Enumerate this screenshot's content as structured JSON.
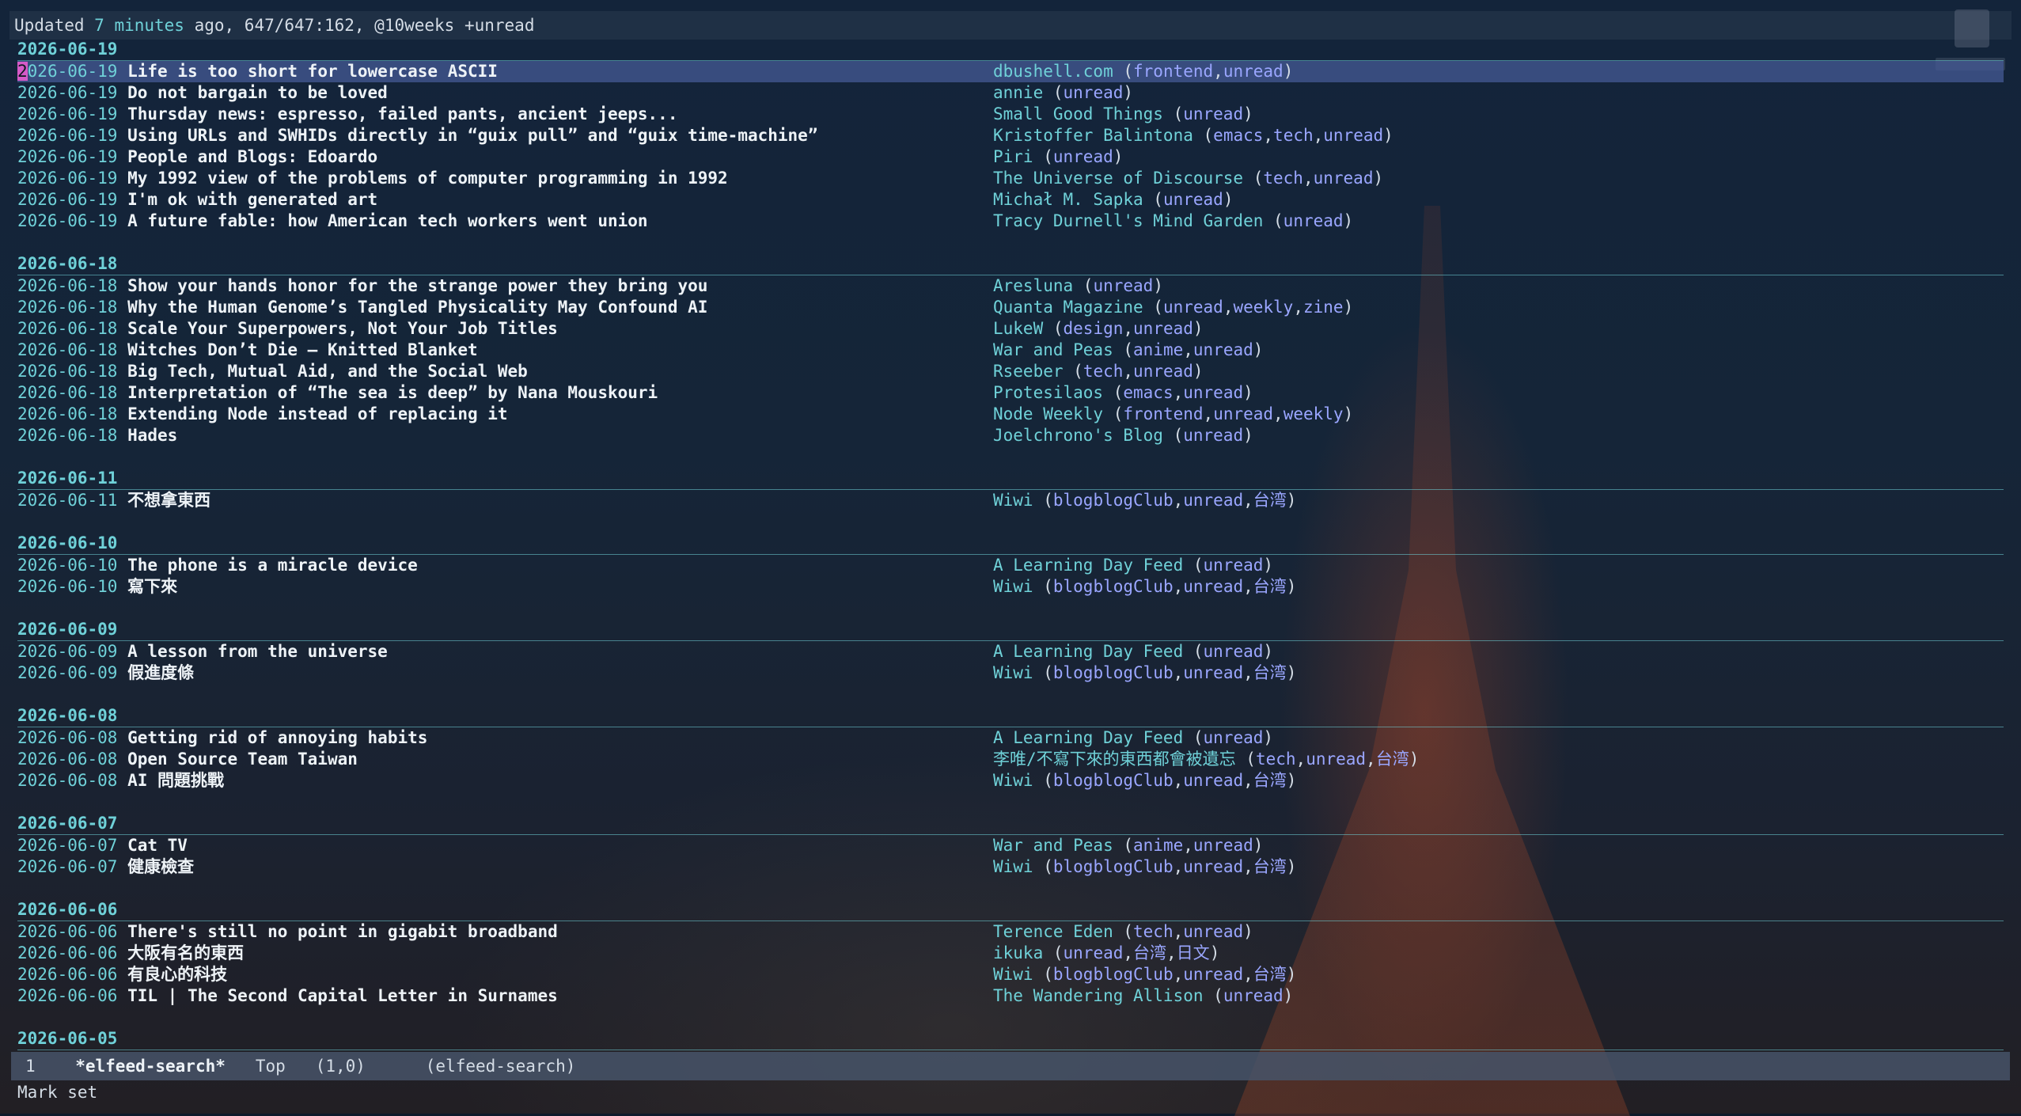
{
  "header": {
    "prefix": "Updated ",
    "age": "7 minutes",
    "suffix": " ago, 647/647:162, @10weeks +unread"
  },
  "groups": [
    {
      "date": "2026-06-19",
      "rows": [
        {
          "date": "2026-06-19",
          "title": "Life is too short for lowercase ASCII",
          "feed": "dbushell.com",
          "tags": [
            "frontend",
            "unread"
          ],
          "selected": true
        },
        {
          "date": "2026-06-19",
          "title": "Do not bargain to be loved",
          "feed": "annie",
          "tags": [
            "unread"
          ]
        },
        {
          "date": "2026-06-19",
          "title": "Thursday news: espresso, failed pants, ancient jeeps...",
          "feed": "Small Good Things",
          "tags": [
            "unread"
          ]
        },
        {
          "date": "2026-06-19",
          "title": "Using URLs and SWHIDs directly in “guix pull” and “guix time-machine”",
          "feed": "Kristoffer Balintona",
          "tags": [
            "emacs",
            "tech",
            "unread"
          ]
        },
        {
          "date": "2026-06-19",
          "title": "People and Blogs: Edoardo",
          "feed": "Piri",
          "tags": [
            "unread"
          ]
        },
        {
          "date": "2026-06-19",
          "title": "My 1992 view of the problems of computer programming in 1992",
          "feed": "The Universe of Discourse",
          "tags": [
            "tech",
            "unread"
          ]
        },
        {
          "date": "2026-06-19",
          "title": "I'm ok with generated art",
          "feed": "Michał M. Sapka",
          "tags": [
            "unread"
          ]
        },
        {
          "date": "2026-06-19",
          "title": "A future fable: how American tech workers went union",
          "feed": "Tracy Durnell's Mind Garden",
          "tags": [
            "unread"
          ]
        }
      ]
    },
    {
      "date": "2026-06-18",
      "rows": [
        {
          "date": "2026-06-18",
          "title": "Show your hands honor for the strange power they bring you",
          "feed": "Aresluna",
          "tags": [
            "unread"
          ]
        },
        {
          "date": "2026-06-18",
          "title": "Why the Human Genome’s Tangled Physicality May Confound AI",
          "feed": "Quanta Magazine",
          "tags": [
            "unread",
            "weekly",
            "zine"
          ]
        },
        {
          "date": "2026-06-18",
          "title": "Scale Your Superpowers, Not Your Job Titles",
          "feed": "LukeW",
          "tags": [
            "design",
            "unread"
          ]
        },
        {
          "date": "2026-06-18",
          "title": "Witches Don’t Die – Knitted Blanket",
          "feed": "War and Peas",
          "tags": [
            "anime",
            "unread"
          ]
        },
        {
          "date": "2026-06-18",
          "title": "Big Tech, Mutual Aid, and the Social Web",
          "feed": "Rseeber",
          "tags": [
            "tech",
            "unread"
          ]
        },
        {
          "date": "2026-06-18",
          "title": "Interpretation of “The sea is deep” by Nana Mouskouri",
          "feed": "Protesilaos",
          "tags": [
            "emacs",
            "unread"
          ]
        },
        {
          "date": "2026-06-18",
          "title": "Extending Node instead of replacing it",
          "feed": "Node Weekly",
          "tags": [
            "frontend",
            "unread",
            "weekly"
          ]
        },
        {
          "date": "2026-06-18",
          "title": "Hades",
          "feed": "Joelchrono's Blog",
          "tags": [
            "unread"
          ]
        }
      ]
    },
    {
      "date": "2026-06-11",
      "rows": [
        {
          "date": "2026-06-11",
          "title": "不想拿東西",
          "feed": "Wiwi",
          "tags": [
            "blogblogClub",
            "unread",
            "台湾"
          ]
        }
      ]
    },
    {
      "date": "2026-06-10",
      "rows": [
        {
          "date": "2026-06-10",
          "title": "The phone is a miracle device",
          "feed": "A Learning Day Feed",
          "tags": [
            "unread"
          ]
        },
        {
          "date": "2026-06-10",
          "title": "寫下來",
          "feed": "Wiwi",
          "tags": [
            "blogblogClub",
            "unread",
            "台湾"
          ]
        }
      ]
    },
    {
      "date": "2026-06-09",
      "rows": [
        {
          "date": "2026-06-09",
          "title": "A lesson from the universe",
          "feed": "A Learning Day Feed",
          "tags": [
            "unread"
          ]
        },
        {
          "date": "2026-06-09",
          "title": "假進度條",
          "feed": "Wiwi",
          "tags": [
            "blogblogClub",
            "unread",
            "台湾"
          ]
        }
      ]
    },
    {
      "date": "2026-06-08",
      "rows": [
        {
          "date": "2026-06-08",
          "title": "Getting rid of annoying habits",
          "feed": "A Learning Day Feed",
          "tags": [
            "unread"
          ]
        },
        {
          "date": "2026-06-08",
          "title": "Open Source Team Taiwan",
          "feed": "李唯/不寫下來的東西都會被遺忘",
          "tags": [
            "tech",
            "unread",
            "台湾"
          ]
        },
        {
          "date": "2026-06-08",
          "title": "AI 問題挑戰",
          "feed": "Wiwi",
          "tags": [
            "blogblogClub",
            "unread",
            "台湾"
          ]
        }
      ]
    },
    {
      "date": "2026-06-07",
      "rows": [
        {
          "date": "2026-06-07",
          "title": "Cat TV",
          "feed": "War and Peas",
          "tags": [
            "anime",
            "unread"
          ]
        },
        {
          "date": "2026-06-07",
          "title": "健康檢查",
          "feed": "Wiwi",
          "tags": [
            "blogblogClub",
            "unread",
            "台湾"
          ]
        }
      ]
    },
    {
      "date": "2026-06-06",
      "rows": [
        {
          "date": "2026-06-06",
          "title": "There's still no point in gigabit broadband",
          "feed": "Terence Eden",
          "tags": [
            "tech",
            "unread"
          ]
        },
        {
          "date": "2026-06-06",
          "title": "大阪有名的東西",
          "feed": "ikuka",
          "tags": [
            "unread",
            "台湾",
            "日文"
          ]
        },
        {
          "date": "2026-06-06",
          "title": "有良心的科技",
          "feed": "Wiwi",
          "tags": [
            "blogblogClub",
            "unread",
            "台湾"
          ]
        },
        {
          "date": "2026-06-06",
          "title": "TIL | The Second Capital Letter in Surnames",
          "feed": "The Wandering Allison",
          "tags": [
            "unread"
          ]
        }
      ]
    },
    {
      "date": "2026-06-05",
      "rows": []
    }
  ],
  "statusbar": {
    "line": "1",
    "buffer": "*elfeed-search*",
    "position": "Top",
    "cursor": "(1,0)",
    "mode": "(elfeed-search)"
  },
  "minibuffer": "Mark set"
}
